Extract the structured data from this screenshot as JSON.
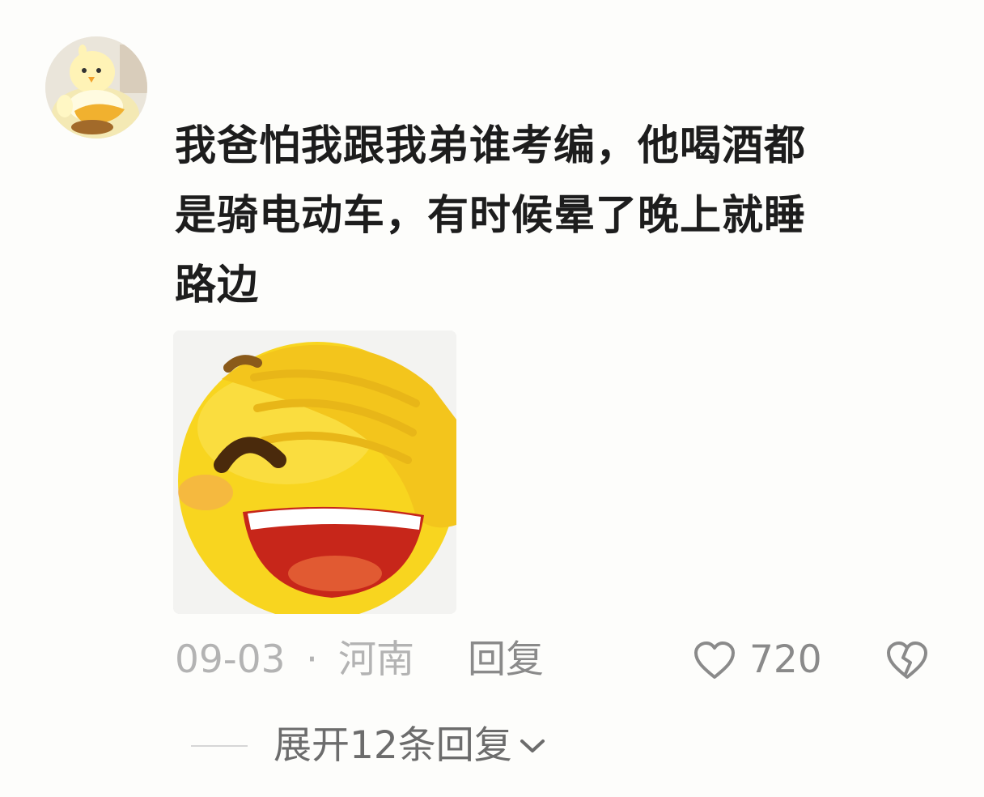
{
  "comment": {
    "avatar_icon": "chick-avatar-icon",
    "lines": [
      "我爸怕我跟我弟谁考编，他喝酒都",
      "是骑电动车，有时候晕了晚上就睡",
      "路边"
    ],
    "sticker_icon": "facepalm-laughing-emoji-icon",
    "date": "09-03",
    "separator": "·",
    "location": "河南",
    "reply_label": "回复",
    "like_icon": "heart-icon",
    "like_count": "720",
    "dislike_icon": "broken-heart-icon",
    "expand_label": "展开12条回复",
    "expand_icon": "chevron-down-icon"
  },
  "colors": {
    "background": "#fdfdfb",
    "text_primary": "#1d1d1d",
    "text_meta": "#b3b3b3",
    "text_action": "#8a8a8a",
    "text_expand": "#6c6c6c",
    "emoji_yellow": "#f8d51f"
  }
}
